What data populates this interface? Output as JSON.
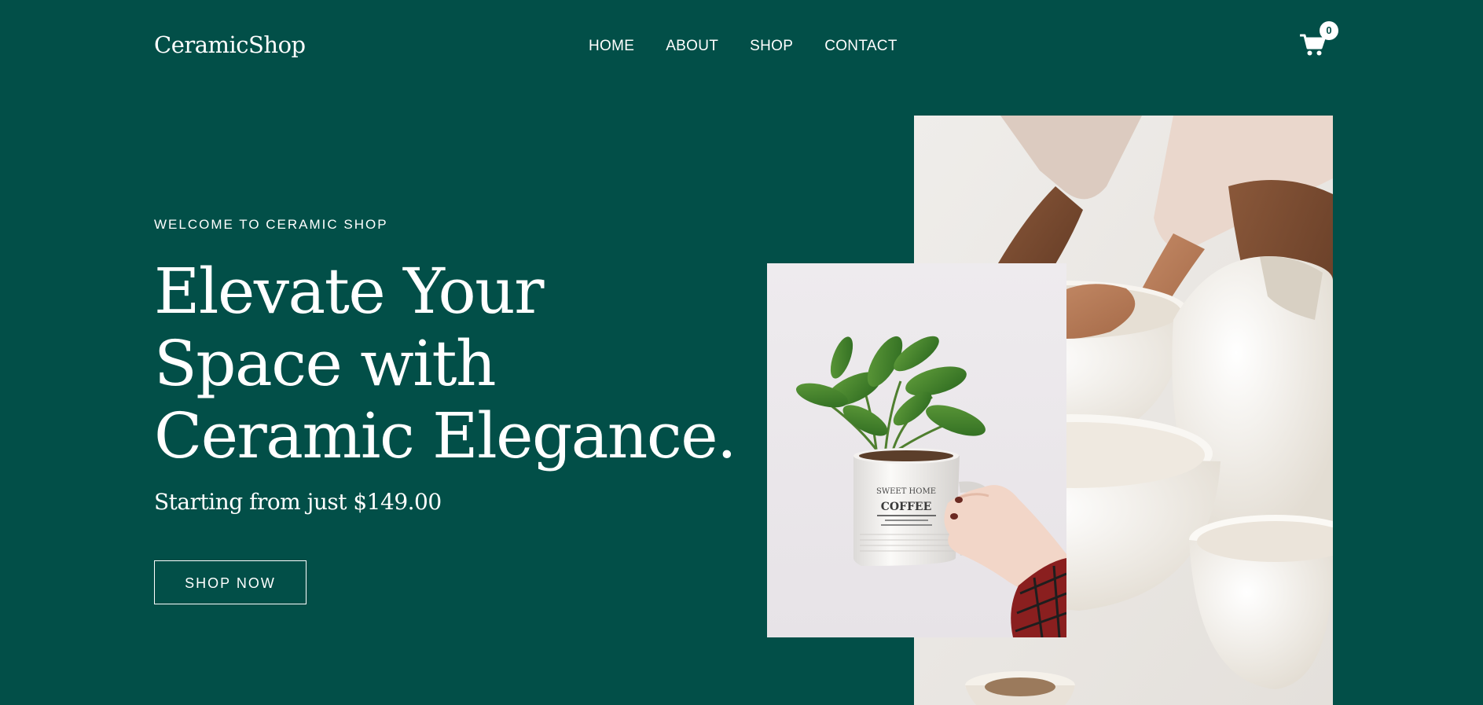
{
  "header": {
    "logo": "CeramicShop",
    "nav": [
      "HOME",
      "ABOUT",
      "SHOP",
      "CONTACT"
    ],
    "cart_icon": "shopping-cart-icon",
    "cart_count": "0"
  },
  "hero": {
    "eyebrow": "WELCOME TO CERAMIC SHOP",
    "headline_lines": [
      "Elevate Your",
      "Space with",
      "Ceramic Elegance."
    ],
    "price_line": "Starting from just $149.00",
    "cta_label": "SHOP NOW"
  },
  "images": {
    "large": "photo of hands shaping white ceramic bowls and vases",
    "small": "photo of a hand holding a coffee mug planted with a green plant",
    "mug_text": [
      "SWEET HOME",
      "COFFEE"
    ]
  },
  "colors": {
    "background": "#024f48",
    "text": "#ffffff",
    "ceramic": "#f4f1ec",
    "skin_dark": "#7a4a30",
    "plant": "#3f7d2a"
  }
}
